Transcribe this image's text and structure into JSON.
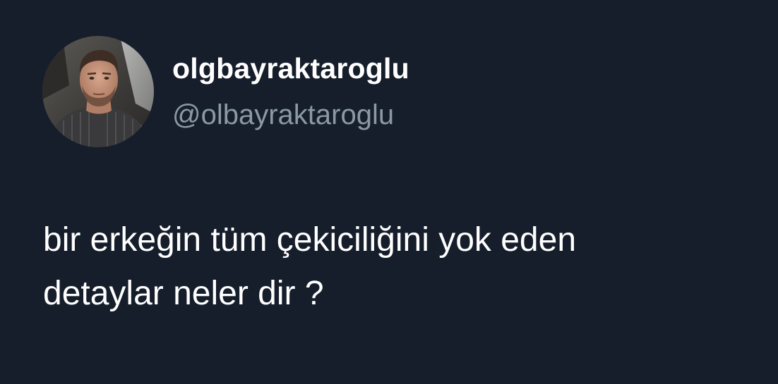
{
  "background_color": "#15202b",
  "text_color": "#ffffff",
  "secondary_color": "#8b98a5",
  "user": {
    "display_name": "olgbayraktaroglu",
    "handle": "@olbayraktaroglu",
    "avatar_icon": "profile-photo"
  },
  "tweet": {
    "lines": [
      "bir erkeğin tüm çekiciliğini yok eden",
      "detaylar neler dir ?"
    ]
  }
}
